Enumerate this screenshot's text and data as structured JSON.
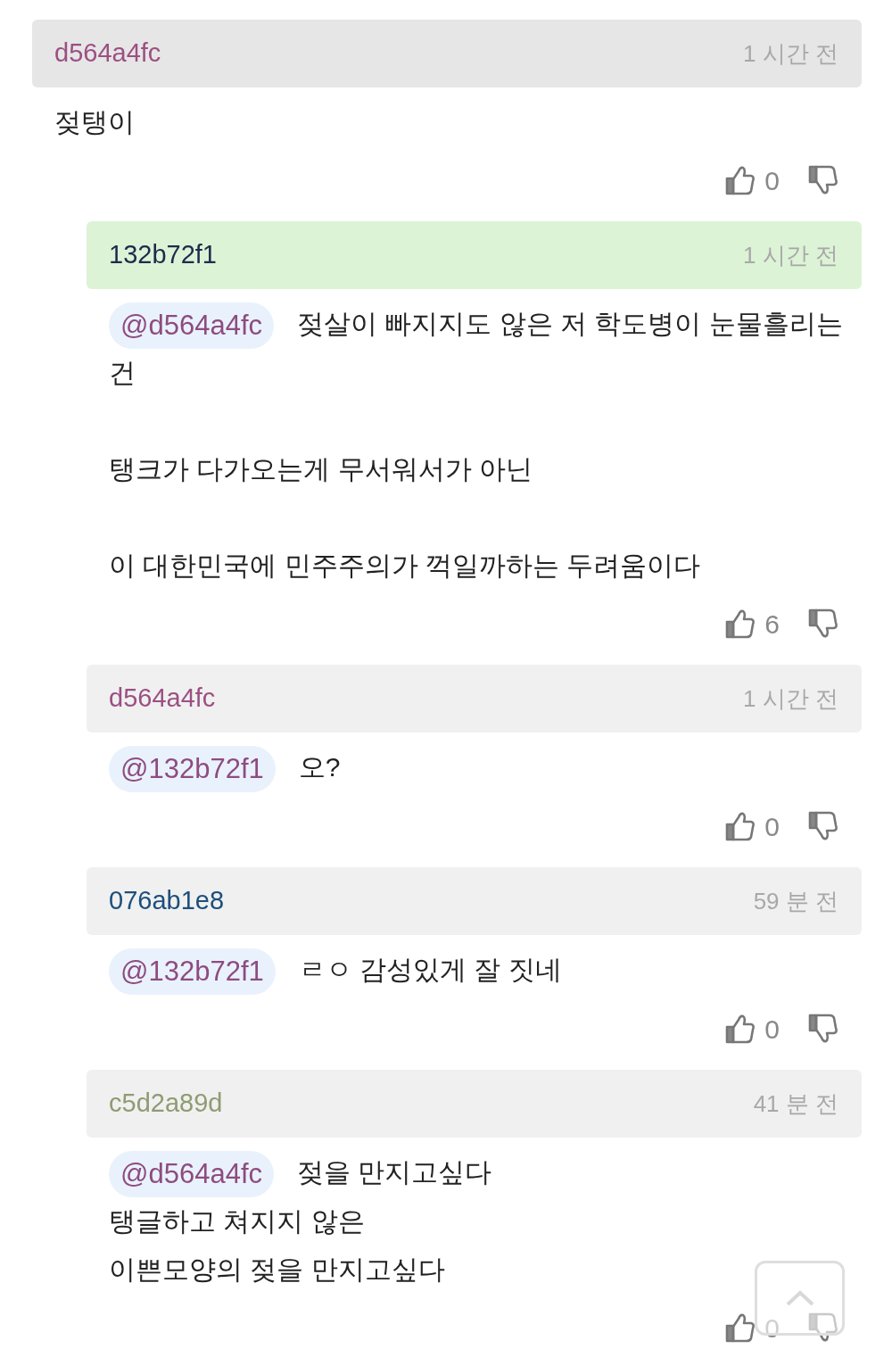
{
  "comments": [
    {
      "author": "d564a4fc",
      "color": "#9c4f82",
      "highlighted": false,
      "time": "1 시간 전",
      "paragraphs": [
        [
          "젖탱이"
        ]
      ],
      "likes": "0",
      "children": [
        {
          "author": "132b72f1",
          "color": "#1d2c4c",
          "highlighted": true,
          "time": "1 시간 전",
          "mention": "@d564a4fc",
          "paragraphs": [
            [
              "젖살이 빠지지도 않은 저 학도병이 눈물흘리는",
              "건"
            ],
            [
              "탱크가 다가오는게 무서워서가 아닌"
            ],
            [
              "이 대한민국에 민주주의가 꺽일까하는 두려움이다"
            ]
          ],
          "likes": "6"
        },
        {
          "author": "d564a4fc",
          "color": "#9c4f82",
          "highlighted": false,
          "time": "1 시간 전",
          "mention": "@132b72f1",
          "paragraphs": [
            [
              "오?"
            ]
          ],
          "likes": "0"
        },
        {
          "author": "076ab1e8",
          "color": "#1c4f7c",
          "highlighted": false,
          "time": "59 분 전",
          "mention": "@132b72f1",
          "paragraphs": [
            [
              "ㄹㅇ 감성있게 잘 짓네"
            ]
          ],
          "likes": "0"
        },
        {
          "author": "c5d2a89d",
          "color": "#8e9c72",
          "highlighted": false,
          "time": "41 분 전",
          "mention": "@d564a4fc",
          "paragraphs": [
            [
              "젖을 만지고싶다",
              "탱글하고 쳐지지 않은",
              "이쁜모양의 젖을 만지고싶다"
            ]
          ],
          "likes": "0"
        }
      ]
    }
  ]
}
